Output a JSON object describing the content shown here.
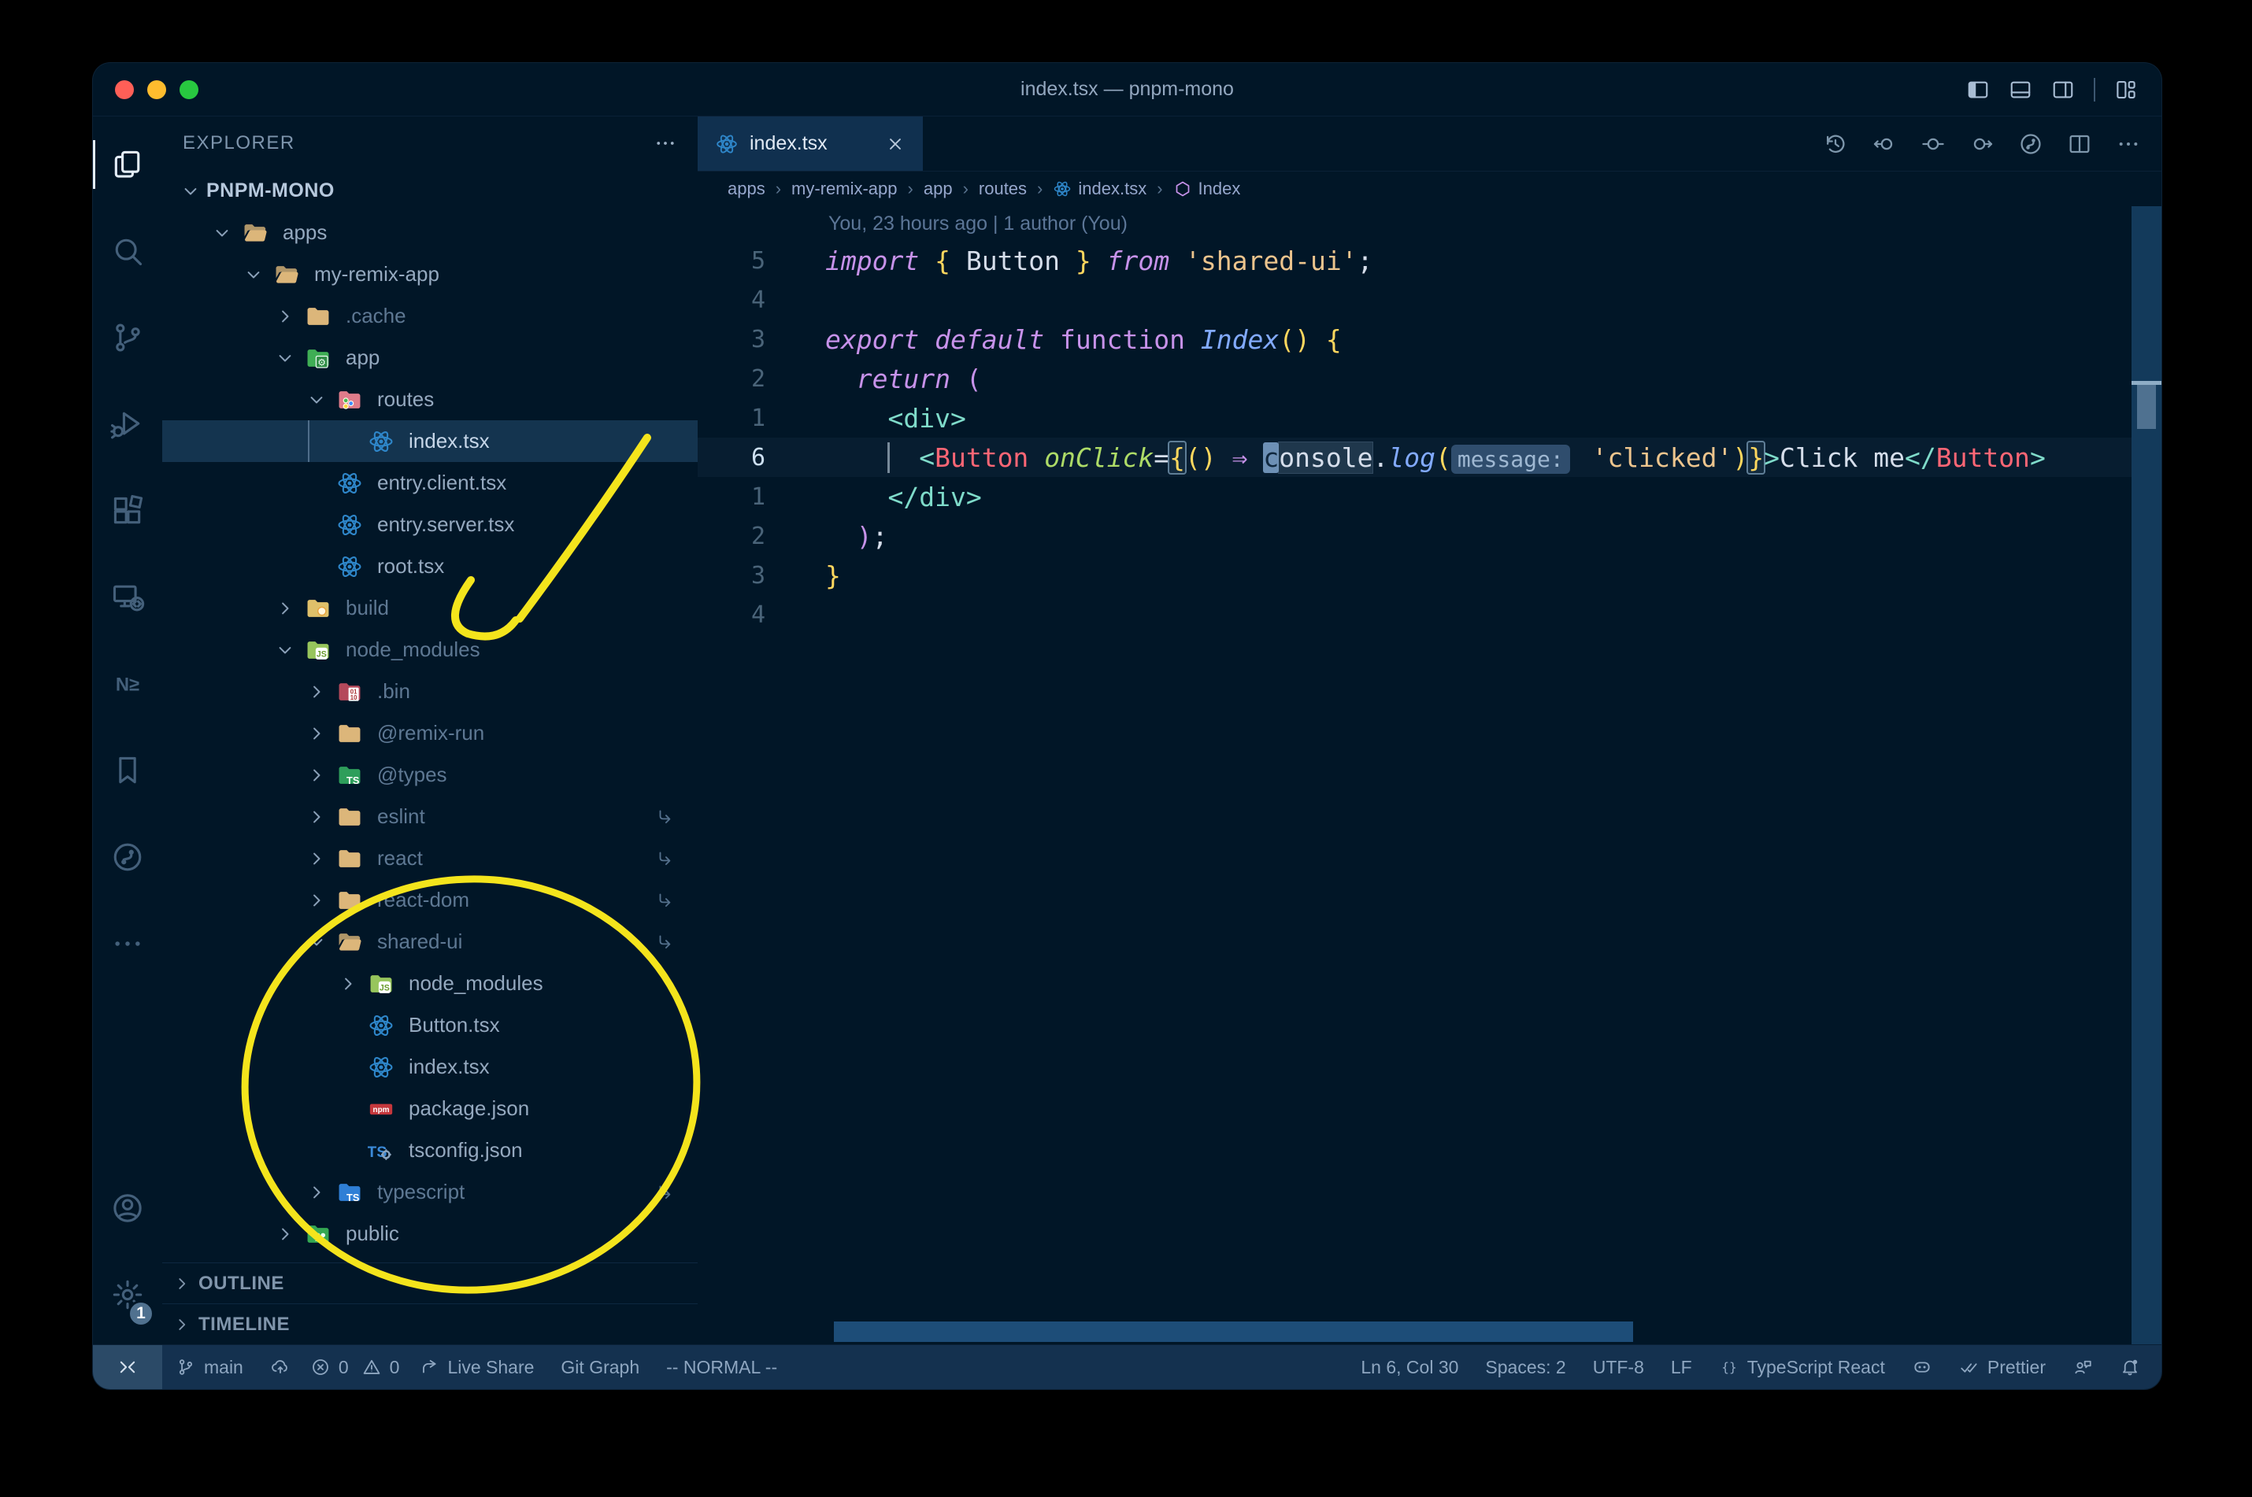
{
  "window": {
    "title": "index.tsx — pnpm-mono"
  },
  "title_bar": {
    "layout_icons": [
      {
        "name": "layout-sidebar-left-icon",
        "icon": "layout-sb-left"
      },
      {
        "name": "layout-panel-icon",
        "icon": "layout-panel"
      },
      {
        "name": "layout-sidebar-right-icon",
        "icon": "layout-sb-right"
      },
      {
        "name": "layout-customize-icon",
        "icon": "layout-grid",
        "divider_before": true
      }
    ],
    "traffic_lights": [
      {
        "name": "close",
        "color": "#ff5f57"
      },
      {
        "name": "minimize",
        "color": "#febc2e"
      },
      {
        "name": "zoom",
        "color": "#28c840"
      }
    ]
  },
  "activity_bar": {
    "top": [
      {
        "name": "explorer",
        "icon": "files",
        "active": true
      },
      {
        "name": "search",
        "icon": "search"
      },
      {
        "name": "source-control",
        "icon": "scm"
      },
      {
        "name": "run-debug",
        "icon": "debug"
      },
      {
        "name": "extensions",
        "icon": "ext"
      },
      {
        "name": "remote-explorer",
        "icon": "remote"
      },
      {
        "name": "nx-console",
        "icon": "nx"
      },
      {
        "name": "bookmarks",
        "icon": "bookmark"
      },
      {
        "name": "git-graph",
        "icon": "gitgraph"
      },
      {
        "name": "more",
        "icon": "more"
      }
    ],
    "bottom": [
      {
        "name": "account",
        "icon": "account"
      },
      {
        "name": "settings",
        "icon": "gear",
        "badge": "1"
      }
    ]
  },
  "explorer": {
    "header": "EXPLORER",
    "tree": [
      {
        "label": "PNPM-MONO",
        "level": 0,
        "chevron": "down",
        "icon": "",
        "root": true
      },
      {
        "label": "apps",
        "level": 1,
        "chevron": "down",
        "icon": "folder-open"
      },
      {
        "label": "my-remix-app",
        "level": 2,
        "chevron": "down",
        "icon": "folder-open"
      },
      {
        "label": ".cache",
        "level": 3,
        "chevron": "right",
        "icon": "folder",
        "dim": true
      },
      {
        "label": "app",
        "level": 3,
        "chevron": "down",
        "icon": "folder-app"
      },
      {
        "label": "routes",
        "level": 4,
        "chevron": "down",
        "icon": "folder-routes"
      },
      {
        "label": "index.tsx",
        "level": 5,
        "chevron": "none",
        "icon": "react",
        "selected": true
      },
      {
        "label": "entry.client.tsx",
        "level": 4,
        "chevron": "none",
        "icon": "react"
      },
      {
        "label": "entry.server.tsx",
        "level": 4,
        "chevron": "none",
        "icon": "react"
      },
      {
        "label": "root.tsx",
        "level": 4,
        "chevron": "none",
        "icon": "react"
      },
      {
        "label": "build",
        "level": 3,
        "chevron": "right",
        "icon": "folder-build",
        "dim": true
      },
      {
        "label": "node_modules",
        "level": 3,
        "chevron": "down",
        "icon": "folder-nm",
        "dim": true
      },
      {
        "label": ".bin",
        "level": 4,
        "chevron": "right",
        "icon": "folder-bin",
        "dim": true
      },
      {
        "label": "@remix-run",
        "level": 4,
        "chevron": "right",
        "icon": "folder",
        "dim": true
      },
      {
        "label": "@types",
        "level": 4,
        "chevron": "right",
        "icon": "folder-types",
        "dim": true
      },
      {
        "label": "eslint",
        "level": 4,
        "chevron": "right",
        "icon": "folder",
        "dim": true,
        "symlink": true
      },
      {
        "label": "react",
        "level": 4,
        "chevron": "right",
        "icon": "folder",
        "dim": true,
        "symlink": true
      },
      {
        "label": "react-dom",
        "level": 4,
        "chevron": "right",
        "icon": "folder",
        "dim": true,
        "symlink": true
      },
      {
        "label": "shared-ui",
        "level": 4,
        "chevron": "down",
        "icon": "folder-open",
        "dim": true,
        "symlink": true
      },
      {
        "label": "node_modules",
        "level": 5,
        "chevron": "right",
        "icon": "folder-nm"
      },
      {
        "label": "Button.tsx",
        "level": 5,
        "chevron": "none",
        "icon": "react"
      },
      {
        "label": "index.tsx",
        "level": 5,
        "chevron": "none",
        "icon": "react"
      },
      {
        "label": "package.json",
        "level": 5,
        "chevron": "none",
        "icon": "npm"
      },
      {
        "label": "tsconfig.json",
        "level": 5,
        "chevron": "none",
        "icon": "tsjson"
      },
      {
        "label": "typescript",
        "level": 4,
        "chevron": "right",
        "icon": "folder-ts",
        "dim": true,
        "symlink": true
      },
      {
        "label": "public",
        "level": 3,
        "chevron": "right",
        "icon": "folder-public"
      }
    ],
    "sections": [
      {
        "label": "OUTLINE"
      },
      {
        "label": "TIMELINE"
      }
    ]
  },
  "editor": {
    "tab": {
      "label": "index.tsx",
      "icon": "react"
    },
    "actions": [
      {
        "name": "timeline",
        "icon": "history"
      },
      {
        "name": "previous-change",
        "icon": "prev-change"
      },
      {
        "name": "open-changes",
        "icon": "open-change"
      },
      {
        "name": "next-change",
        "icon": "next-change"
      },
      {
        "name": "git-graph",
        "icon": "gitgraph"
      },
      {
        "name": "split-editor",
        "icon": "split"
      },
      {
        "name": "more-actions",
        "icon": "more"
      }
    ],
    "breadcrumbs": [
      {
        "label": "apps"
      },
      {
        "label": "my-remix-app"
      },
      {
        "label": "app"
      },
      {
        "label": "routes"
      },
      {
        "label": "index.tsx",
        "icon": "react"
      },
      {
        "label": "Index",
        "icon": "symbol-class"
      }
    ],
    "blame": "You, 23 hours ago | 1 author (You)",
    "lines": [
      {
        "num": "5",
        "tokens": [
          {
            "c": "k",
            "t": "import"
          },
          {
            "c": "v",
            "t": " "
          },
          {
            "c": "b",
            "t": "{"
          },
          {
            "c": "v",
            "t": " Button "
          },
          {
            "c": "b",
            "t": "}"
          },
          {
            "c": "k",
            "t": " from "
          },
          {
            "c": "s",
            "t": "'shared-ui'"
          },
          {
            "c": "v",
            "t": ";"
          }
        ]
      },
      {
        "num": "4",
        "tokens": []
      },
      {
        "num": "3",
        "tokens": [
          {
            "c": "k",
            "t": "export"
          },
          {
            "c": "v",
            "t": " "
          },
          {
            "c": "k",
            "t": "default"
          },
          {
            "c": "v",
            "t": " "
          },
          {
            "c": "k2",
            "t": "function"
          },
          {
            "c": "v",
            "t": " "
          },
          {
            "c": "f",
            "t": "Index"
          },
          {
            "c": "b",
            "t": "()"
          },
          {
            "c": "v",
            "t": " "
          },
          {
            "c": "b",
            "t": "{"
          }
        ]
      },
      {
        "num": "2",
        "tokens": [
          {
            "c": "v",
            "t": "  "
          },
          {
            "c": "k",
            "t": "return"
          },
          {
            "c": "v",
            "t": " "
          },
          {
            "c": "p",
            "t": "("
          }
        ]
      },
      {
        "num": "1",
        "tokens": [
          {
            "c": "v",
            "t": "    "
          },
          {
            "c": "t",
            "t": "<div>"
          }
        ]
      },
      {
        "num": "6",
        "active": true,
        "tokens": [
          {
            "c": "v",
            "t": "      "
          },
          {
            "c": "t",
            "t": "<"
          },
          {
            "c": "c",
            "t": "Button"
          },
          {
            "c": "v",
            "t": " "
          },
          {
            "c": "a",
            "t": "onClick"
          },
          {
            "c": "v",
            "t": "="
          },
          {
            "c": "bm",
            "t": "{"
          },
          {
            "c": "b",
            "t": "()"
          },
          {
            "c": "v",
            "t": " "
          },
          {
            "c": "ar",
            "t": "⇒"
          },
          {
            "c": "v",
            "t": " "
          },
          {
            "c": "cur",
            "t": "c"
          },
          {
            "c": "whl",
            "t": "onsole"
          },
          {
            "c": "v",
            "t": "."
          },
          {
            "c": "f",
            "t": "log"
          },
          {
            "c": "b",
            "t": "("
          },
          {
            "c": "inlay",
            "t": "message:"
          },
          {
            "c": "v",
            "t": " "
          },
          {
            "c": "s",
            "t": "'clicked'"
          },
          {
            "c": "b",
            "t": ")"
          },
          {
            "c": "bm",
            "t": "}"
          },
          {
            "c": "t",
            "t": ">"
          },
          {
            "c": "v",
            "t": "Click me"
          },
          {
            "c": "t",
            "t": "</"
          },
          {
            "c": "c",
            "t": "Button"
          },
          {
            "c": "t",
            "t": ">"
          }
        ]
      },
      {
        "num": "1",
        "tokens": [
          {
            "c": "v",
            "t": "    "
          },
          {
            "c": "t",
            "t": "</div>"
          }
        ]
      },
      {
        "num": "2",
        "tokens": [
          {
            "c": "v",
            "t": "  "
          },
          {
            "c": "p",
            "t": ")"
          },
          {
            "c": "v",
            "t": ";"
          }
        ]
      },
      {
        "num": "3",
        "tokens": [
          {
            "c": "b",
            "t": "}"
          }
        ]
      },
      {
        "num": "4",
        "tokens": []
      }
    ]
  },
  "status_bar": {
    "remote_icon": "remote-sb",
    "left": [
      {
        "name": "branch",
        "icon": "branch",
        "label": "main"
      },
      {
        "name": "sync",
        "icon": "cloud-up",
        "label": ""
      },
      {
        "name": "errors",
        "icon": "err",
        "label": "0",
        "tight": true
      },
      {
        "name": "warnings",
        "icon": "warn",
        "label": "0",
        "tight": true
      },
      {
        "name": "live-share",
        "icon": "liveshare",
        "label": "Live Share"
      },
      {
        "name": "git-graph",
        "icon": "",
        "label": "Git Graph"
      },
      {
        "name": "vim-mode",
        "icon": "",
        "label": "-- NORMAL --"
      }
    ],
    "right": [
      {
        "name": "cursor-position",
        "icon": "",
        "label": "Ln 6, Col 30"
      },
      {
        "name": "indentation",
        "icon": "",
        "label": "Spaces: 2"
      },
      {
        "name": "encoding",
        "icon": "",
        "label": "UTF-8"
      },
      {
        "name": "eol",
        "icon": "",
        "label": "LF"
      },
      {
        "name": "language-mode",
        "icon": "braces",
        "label": "TypeScript React"
      },
      {
        "name": "copilot",
        "icon": "copilot",
        "label": ""
      },
      {
        "name": "prettier",
        "icon": "check2",
        "label": "Prettier"
      },
      {
        "name": "feedback",
        "icon": "feedback",
        "label": ""
      },
      {
        "name": "notifications",
        "icon": "bell",
        "label": ""
      }
    ]
  },
  "annotations": {
    "color": "#f4e41c",
    "shapes": [
      "hand-drawn arrow pointing to node_modules",
      "hand-drawn circle around shared-ui package contents"
    ]
  }
}
